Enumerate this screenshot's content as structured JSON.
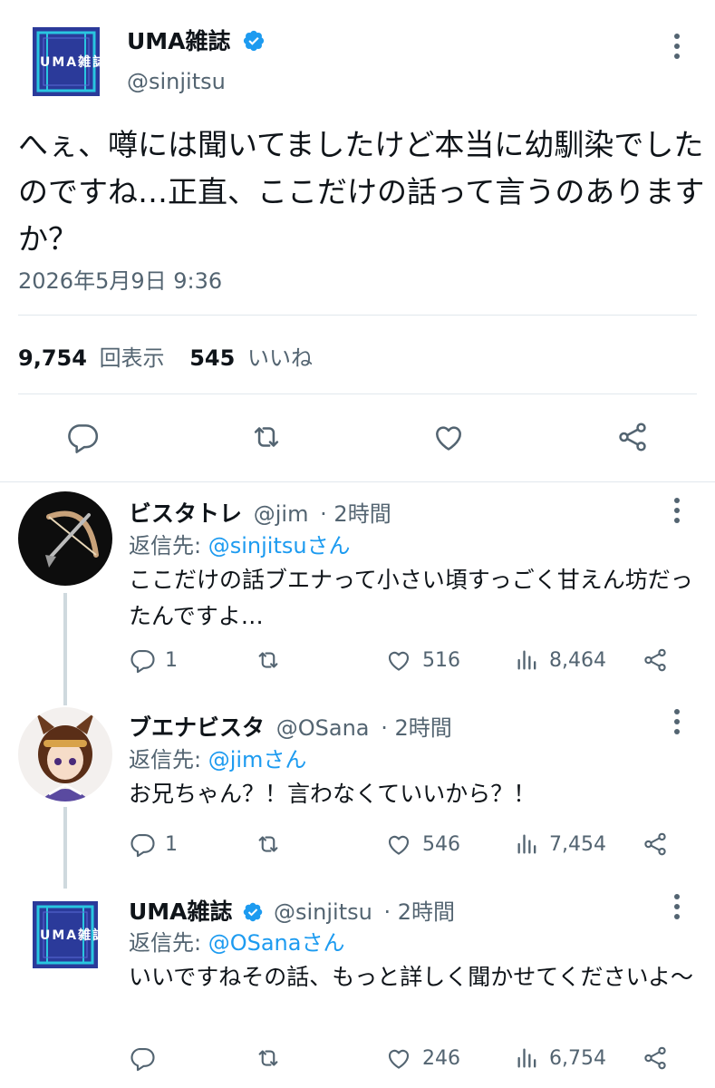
{
  "main_tweet": {
    "name": "UMA雑誌",
    "handle": "@sinjitsu",
    "logo_text": "UMA雑誌",
    "text": "へぇ、噂には聞いてましたけど本当に幼馴染でしたのですね…正直、ここだけの話って言うのありますか？",
    "timestamp": "2026年5月9日 9:36",
    "views_count": "9,754",
    "views_label": "回表示",
    "likes_count": "545",
    "likes_label": "いいね",
    "icons": [
      "reply-icon",
      "retweet-icon",
      "like-icon",
      "share-icon"
    ]
  },
  "replies": [
    {
      "name": "ビスタトレ",
      "handle": "@jim",
      "time": "· 2時間",
      "reply_prefix": "返信先: ",
      "reply_target": "@sinjitsuさん",
      "text": "ここだけの話ブエナって小さい頃すっごく甘えん坊だったんですよ…",
      "reply_count": "1",
      "like_count": "516",
      "view_count": "8,464"
    },
    {
      "name": "ブエナビスタ",
      "handle": "@OSana",
      "time": "· 2時間",
      "reply_prefix": "返信先: ",
      "reply_target": "@jimさん",
      "text": "お兄ちゃん？！言わなくていいから？！",
      "reply_count": "1",
      "like_count": "546",
      "view_count": "7,454"
    },
    {
      "name": "UMA雑誌",
      "handle": "@sinjitsu",
      "time": "· 2時間",
      "reply_prefix": "返信先: ",
      "reply_target": "@OSanaさん",
      "text": "いいですねその話、もっと詳しく聞かせてくださいよ〜",
      "reply_count": "",
      "like_count": "246",
      "view_count": "6,754"
    }
  ],
  "colors": {
    "accent": "#1d9bf0",
    "text": "#0f1419",
    "secondary": "#536471",
    "logo_bg": "#2b3a9a"
  }
}
